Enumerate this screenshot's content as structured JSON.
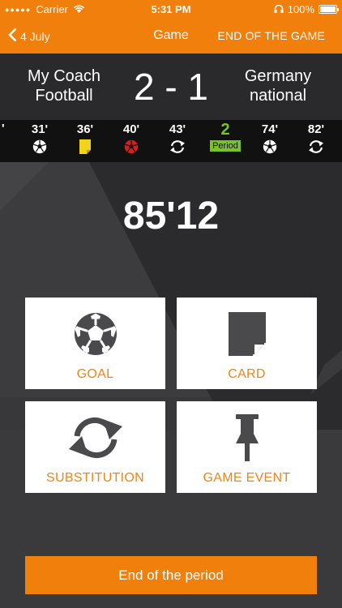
{
  "status_bar": {
    "carrier": "Carrier",
    "time": "5:31 PM",
    "battery": "100%"
  },
  "nav": {
    "back_label": "4 July",
    "title": "Game",
    "end_game_label": "END OF THE GAME"
  },
  "score": {
    "home_team_line1": "My Coach",
    "home_team_line2": "Football",
    "result": "2 - 1",
    "away_team_line1": "Germany",
    "away_team_line2": "national"
  },
  "timeline": {
    "lead": "'",
    "events": [
      {
        "minute": "31'",
        "icon": "goal-ball-icon"
      },
      {
        "minute": "36'",
        "icon": "yellow-card-icon"
      },
      {
        "minute": "40'",
        "icon": "red-ball-icon"
      },
      {
        "minute": "43'",
        "icon": "substitution-icon"
      },
      {
        "minute": "2",
        "icon": "period-badge",
        "badge": "Period"
      },
      {
        "minute": "74'",
        "icon": "goal-ball-icon"
      },
      {
        "minute": "82'",
        "icon": "substitution-icon"
      }
    ]
  },
  "timer": "85'12",
  "actions": {
    "goal": "GOAL",
    "card": "CARD",
    "substitution": "SUBSTITUTION",
    "game_event": "GAME EVENT"
  },
  "end_period_label": "End of the period",
  "colors": {
    "accent": "#f07f0c",
    "period_green": "#7bc12a",
    "yellow_card": "#f2d21b",
    "red_event": "#d41f1f"
  }
}
